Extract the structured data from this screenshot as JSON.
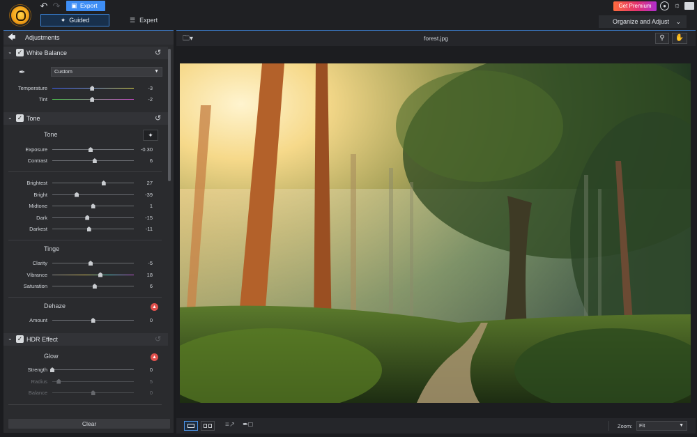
{
  "app": {
    "export_label": "Export",
    "tabs": [
      {
        "label": "Guided"
      },
      {
        "label": "Expert"
      }
    ],
    "get_premium": "Get Premium",
    "workspace": "Organize and Adjust",
    "icons": [
      "undo-icon",
      "redo-icon",
      "export-icon",
      "magic-wand-icon",
      "layers-icon",
      "account-icon",
      "brightness-icon",
      "screen-icon"
    ]
  },
  "adjustments": {
    "title": "Adjustments",
    "clear_label": "Clear",
    "white_balance": {
      "title": "White Balance",
      "preset": "Custom",
      "rows": [
        {
          "label": "Temperature",
          "value": "-3",
          "fraction": 0.49
        },
        {
          "label": "Tint",
          "value": "-2",
          "fraction": 0.49
        }
      ]
    },
    "tone": {
      "title": "Tone",
      "tone_sub": "Tone",
      "tone_rows": [
        {
          "label": "Exposure",
          "value": "-0.30",
          "fraction": 0.47
        },
        {
          "label": "Contrast",
          "value": "6",
          "fraction": 0.52
        }
      ],
      "light_rows": [
        {
          "label": "Brightest",
          "value": "27",
          "fraction": 0.63
        },
        {
          "label": "Bright",
          "value": "-39",
          "fraction": 0.3
        },
        {
          "label": "Midtone",
          "value": "1",
          "fraction": 0.5
        },
        {
          "label": "Dark",
          "value": "-15",
          "fraction": 0.43
        },
        {
          "label": "Darkest",
          "value": "-11",
          "fraction": 0.45
        }
      ],
      "tinge_sub": "Tinge",
      "tinge_rows": [
        {
          "label": "Clarity",
          "value": "-5",
          "fraction": 0.47
        },
        {
          "label": "Vibrance",
          "value": "18",
          "fraction": 0.59
        },
        {
          "label": "Saturation",
          "value": "6",
          "fraction": 0.52
        }
      ],
      "dehaze_sub": "Dehaze",
      "dehaze_rows": [
        {
          "label": "Amount",
          "value": "0",
          "fraction": 0.5
        }
      ]
    },
    "hdr": {
      "title": "HDR Effect",
      "glow_sub": "Glow",
      "rows": [
        {
          "label": "Strength",
          "value": "0",
          "fraction": 0.0
        },
        {
          "label": "Radius",
          "value": "5",
          "fraction": 0.08
        },
        {
          "label": "Balance",
          "value": "0",
          "fraction": 0.5
        }
      ]
    }
  },
  "viewer": {
    "file_name": "forest.jpg",
    "zoom_label": "Zoom:",
    "zoom_value": "Fit"
  }
}
